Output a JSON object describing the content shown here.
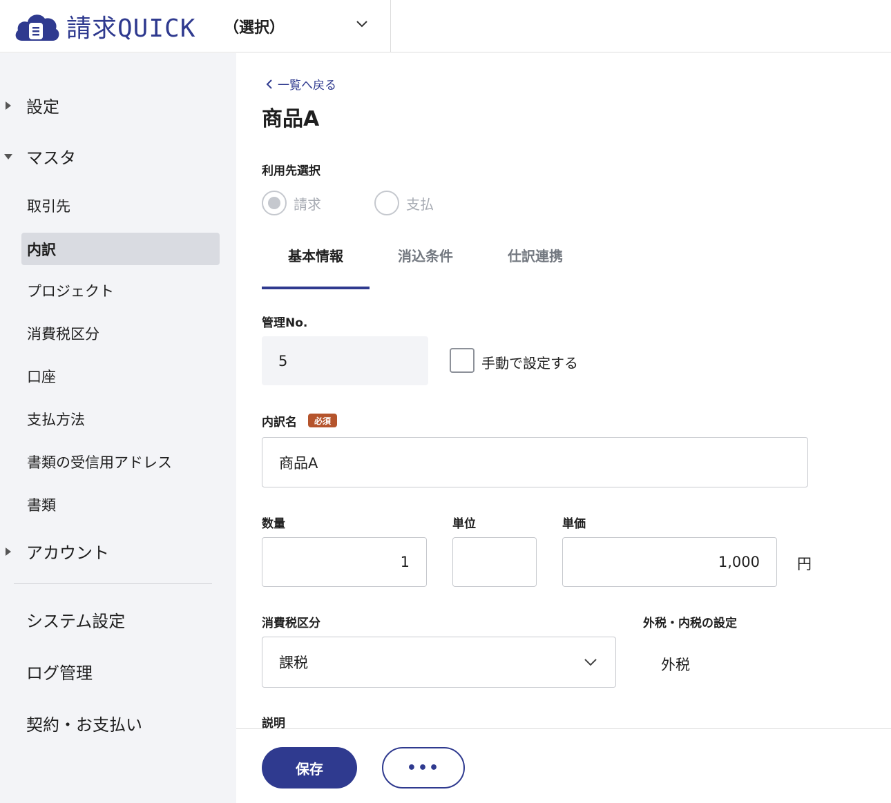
{
  "header": {
    "app_name": "請求QUICK",
    "org_select": "（選択）"
  },
  "sidebar": {
    "sections": [
      {
        "label": "設定",
        "expanded": false
      },
      {
        "label": "マスタ",
        "expanded": true
      },
      {
        "label": "アカウント",
        "expanded": false
      }
    ],
    "master_items": [
      {
        "label": "取引先",
        "active": false
      },
      {
        "label": "内訳",
        "active": true
      },
      {
        "label": "プロジェクト",
        "active": false
      },
      {
        "label": "消費税区分",
        "active": false
      },
      {
        "label": "口座",
        "active": false
      },
      {
        "label": "支払方法",
        "active": false
      },
      {
        "label": "書類の受信用アドレス",
        "active": false
      },
      {
        "label": "書類",
        "active": false
      }
    ],
    "bottom_items": [
      "システム設定",
      "ログ管理",
      "契約・お支払い"
    ]
  },
  "main": {
    "back_link": "一覧へ戻る",
    "title": "商品A",
    "usage_label": "利用先選択",
    "usage_options": [
      {
        "label": "請求",
        "selected": true
      },
      {
        "label": "支払",
        "selected": false
      }
    ],
    "tabs": [
      {
        "label": "基本情報",
        "active": true
      },
      {
        "label": "消込条件",
        "active": false
      },
      {
        "label": "仕訳連携",
        "active": false
      }
    ],
    "management_no": {
      "label": "管理No.",
      "value": "5",
      "manual_label": "手動で設定する",
      "manual_checked": false
    },
    "item_name": {
      "label": "内訳名",
      "required_badge": "必須",
      "value": "商品A"
    },
    "quantity": {
      "label": "数量",
      "value": "1"
    },
    "unit": {
      "label": "単位",
      "value": ""
    },
    "unit_price": {
      "label": "単価",
      "value": "1,000",
      "currency": "円"
    },
    "tax_category": {
      "label": "消費税区分",
      "value": "課税"
    },
    "tax_mode": {
      "label": "外税・内税の設定",
      "value": "外税"
    },
    "description_label": "説明"
  },
  "footer": {
    "save_label": "保存",
    "more_label": "•••"
  },
  "colors": {
    "brand": "#2f3a8f",
    "required_badge": "#b5542c",
    "sidebar_bg": "#f3f4f7",
    "active_item_bg": "#d9dbe1"
  }
}
